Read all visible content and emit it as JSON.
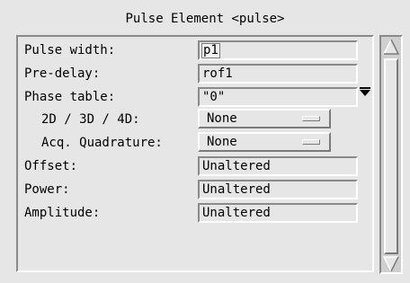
{
  "window": {
    "title": "Pulse Element <pulse>"
  },
  "fields": {
    "pulse_width": {
      "label": "Pulse width:",
      "value": "p1"
    },
    "pre_delay": {
      "label": "Pre-delay:",
      "value": "rof1"
    },
    "phase_table": {
      "label": "Phase table:",
      "value": "\"0\""
    },
    "dim": {
      "label": "2D / 3D / 4D:",
      "value": "None"
    },
    "acq_quadrature": {
      "label": "Acq. Quadrature:",
      "value": "None"
    },
    "offset": {
      "label": "Offset:",
      "value": "Unaltered"
    },
    "power": {
      "label": "Power:",
      "value": "Unaltered"
    },
    "amplitude": {
      "label": "Amplitude:",
      "value": "Unaltered"
    }
  },
  "icons": {
    "phase_dropdown": "dropdown-arrow-icon",
    "menu_indicator": "option-menu-indicator-icon",
    "scroll_up": "scroll-up-arrow-icon",
    "scroll_down": "scroll-down-arrow-icon"
  },
  "colors": {
    "background": "#e6e6e6",
    "shadow": "#8a8a8a",
    "highlight": "#ffffff"
  }
}
